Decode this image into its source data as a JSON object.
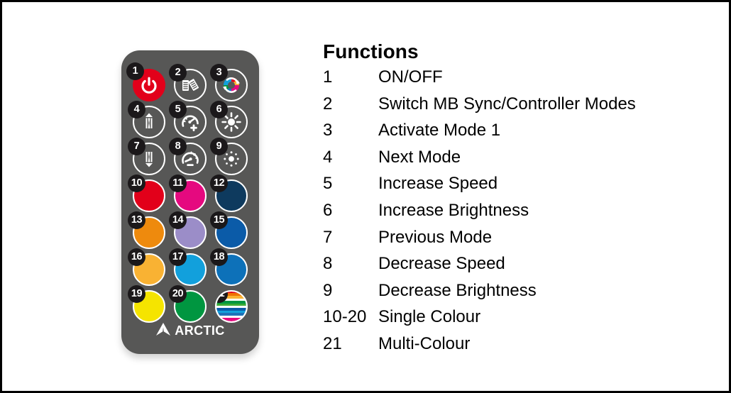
{
  "remote": {
    "body_color": "#575756",
    "badge_color": "#1b181a",
    "brand": "ARCTIC",
    "brand_icon": "arctic-mountain-logo",
    "buttons": [
      {
        "n": "1",
        "type": "icon",
        "icon": "power-icon",
        "color": "#e2001a"
      },
      {
        "n": "2",
        "type": "icon",
        "icon": "mb-sync-switch-icon",
        "color": "#ffffff"
      },
      {
        "n": "3",
        "type": "icon",
        "icon": "color-wheel-cycle-icon",
        "color": "#ffffff"
      },
      {
        "n": "4",
        "type": "icon",
        "icon": "next-mode-up-arrow-icon",
        "color": "#ffffff"
      },
      {
        "n": "5",
        "type": "icon",
        "icon": "speed-plus-gauge-icon",
        "color": "#ffffff"
      },
      {
        "n": "6",
        "type": "icon",
        "icon": "brightness-high-sun-icon",
        "color": "#ffffff"
      },
      {
        "n": "7",
        "type": "icon",
        "icon": "prev-mode-down-arrow-icon",
        "color": "#ffffff"
      },
      {
        "n": "8",
        "type": "icon",
        "icon": "speed-minus-gauge-icon",
        "color": "#ffffff"
      },
      {
        "n": "9",
        "type": "icon",
        "icon": "brightness-low-sun-icon",
        "color": "#ffffff"
      },
      {
        "n": "10",
        "type": "color",
        "icon": "colour-swatch-red",
        "color": "#e2001a"
      },
      {
        "n": "11",
        "type": "color",
        "icon": "colour-swatch-magenta",
        "color": "#e5097f"
      },
      {
        "n": "12",
        "type": "color",
        "icon": "colour-swatch-navy",
        "color": "#0e3a5e"
      },
      {
        "n": "13",
        "type": "color",
        "icon": "colour-swatch-orange",
        "color": "#ee8a0d"
      },
      {
        "n": "14",
        "type": "color",
        "icon": "colour-swatch-lavender",
        "color": "#9b8dc8"
      },
      {
        "n": "15",
        "type": "color",
        "icon": "colour-swatch-blue",
        "color": "#0b5ba8"
      },
      {
        "n": "16",
        "type": "color",
        "icon": "colour-swatch-amber",
        "color": "#f9b233"
      },
      {
        "n": "17",
        "type": "color",
        "icon": "colour-swatch-cyan-blue",
        "color": "#12a0dc"
      },
      {
        "n": "18",
        "type": "color",
        "icon": "colour-swatch-azure",
        "color": "#0d71b9"
      },
      {
        "n": "19",
        "type": "color",
        "icon": "colour-swatch-yellow",
        "color": "#f5e400"
      },
      {
        "n": "20",
        "type": "color",
        "icon": "colour-swatch-green",
        "color": "#009640"
      },
      {
        "n": "21",
        "type": "multi",
        "icon": "colour-swatch-rainbow",
        "color": "multi"
      }
    ],
    "rainbow_stripes": [
      "#e2001a",
      "#ee7203",
      "#f9b233",
      "#ffffff",
      "#009640",
      "#3aaa35",
      "#ffffff",
      "#0b5ba8",
      "#12a0dc",
      "#1d71b8",
      "#ffffff",
      "#e5097f"
    ]
  },
  "functions": {
    "title": "Functions",
    "rows": [
      {
        "num": "1",
        "label": "ON/OFF"
      },
      {
        "num": "2",
        "label": "Switch MB Sync/Controller Modes"
      },
      {
        "num": "3",
        "label": "Activate Mode 1"
      },
      {
        "num": "4",
        "label": "Next Mode"
      },
      {
        "num": "5",
        "label": "Increase Speed"
      },
      {
        "num": "6",
        "label": "Increase Brightness"
      },
      {
        "num": "7",
        "label": "Previous Mode"
      },
      {
        "num": "8",
        "label": "Decrease Speed"
      },
      {
        "num": "9",
        "label": "Decrease Brightness"
      },
      {
        "num": "10-20",
        "label": "Single Colour"
      },
      {
        "num": "21",
        "label": "Multi-Colour"
      }
    ]
  }
}
